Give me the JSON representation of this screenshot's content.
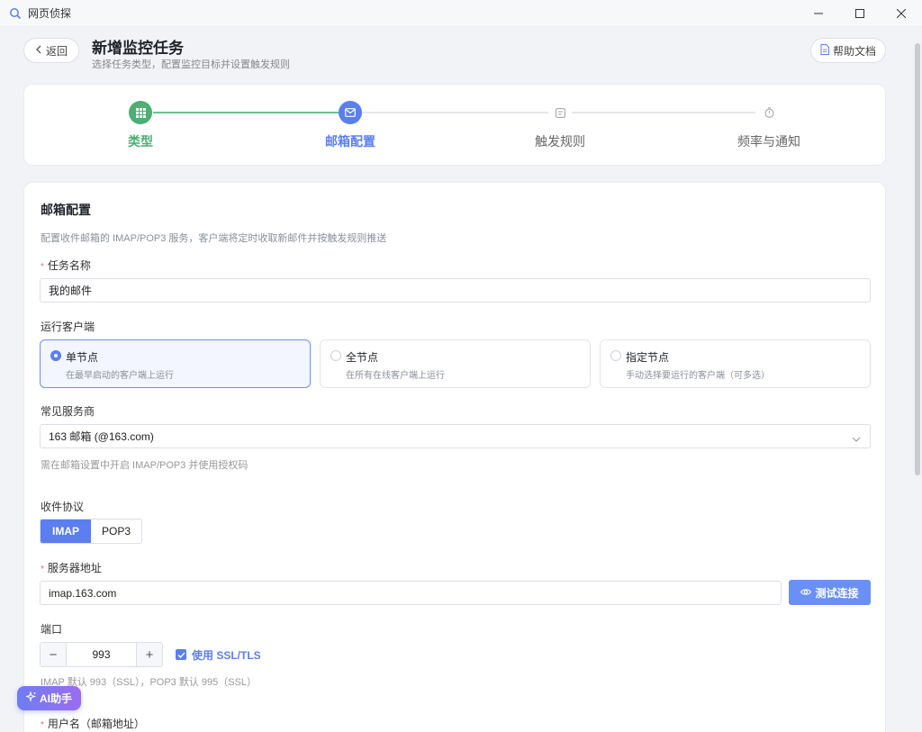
{
  "window": {
    "app_name": "网页侦探"
  },
  "header": {
    "back_label": "返回",
    "title": "新增监控任务",
    "subtitle": "选择任务类型，配置监控目标并设置触发规则",
    "help_label": "帮助文档"
  },
  "steps": [
    {
      "label": "类型",
      "state": "done"
    },
    {
      "label": "邮箱配置",
      "state": "active"
    },
    {
      "label": "触发规则",
      "state": "pending"
    },
    {
      "label": "频率与通知",
      "state": "pending"
    }
  ],
  "form": {
    "section_title": "邮箱配置",
    "section_desc": "配置收件邮箱的 IMAP/POP3 服务，客户端将定时收取新邮件并按触发规则推送",
    "task_name_label": "任务名称",
    "task_name_value": "我的邮件",
    "client_label": "运行客户端",
    "client_options": [
      {
        "title": "单节点",
        "desc": "在最早启动的客户端上运行",
        "selected": true
      },
      {
        "title": "全节点",
        "desc": "在所有在线客户端上运行",
        "selected": false
      },
      {
        "title": "指定节点",
        "desc": "手动选择要运行的客户端（可多选）",
        "selected": false
      }
    ],
    "provider_label": "常见服务商",
    "provider_value": "163 邮箱 (@163.com)",
    "provider_hint": "需在邮箱设置中开启 IMAP/POP3 并使用授权码",
    "protocol_label": "收件协议",
    "protocol_options": [
      "IMAP",
      "POP3"
    ],
    "protocol_selected": "IMAP",
    "server_label": "服务器地址",
    "server_value": "imap.163.com",
    "test_button": "测试连接",
    "port_label": "端口",
    "port_value": "993",
    "ssl_label": "使用 SSL/TLS",
    "ssl_checked": true,
    "port_hint": "IMAP 默认 993（SSL），POP3 默认 995（SSL）",
    "username_label": "用户名（邮箱地址）"
  },
  "ai_button": "AI助手",
  "colors": {
    "primary": "#5b7ff0",
    "success": "#4caf73",
    "required": "#f56c6c"
  }
}
